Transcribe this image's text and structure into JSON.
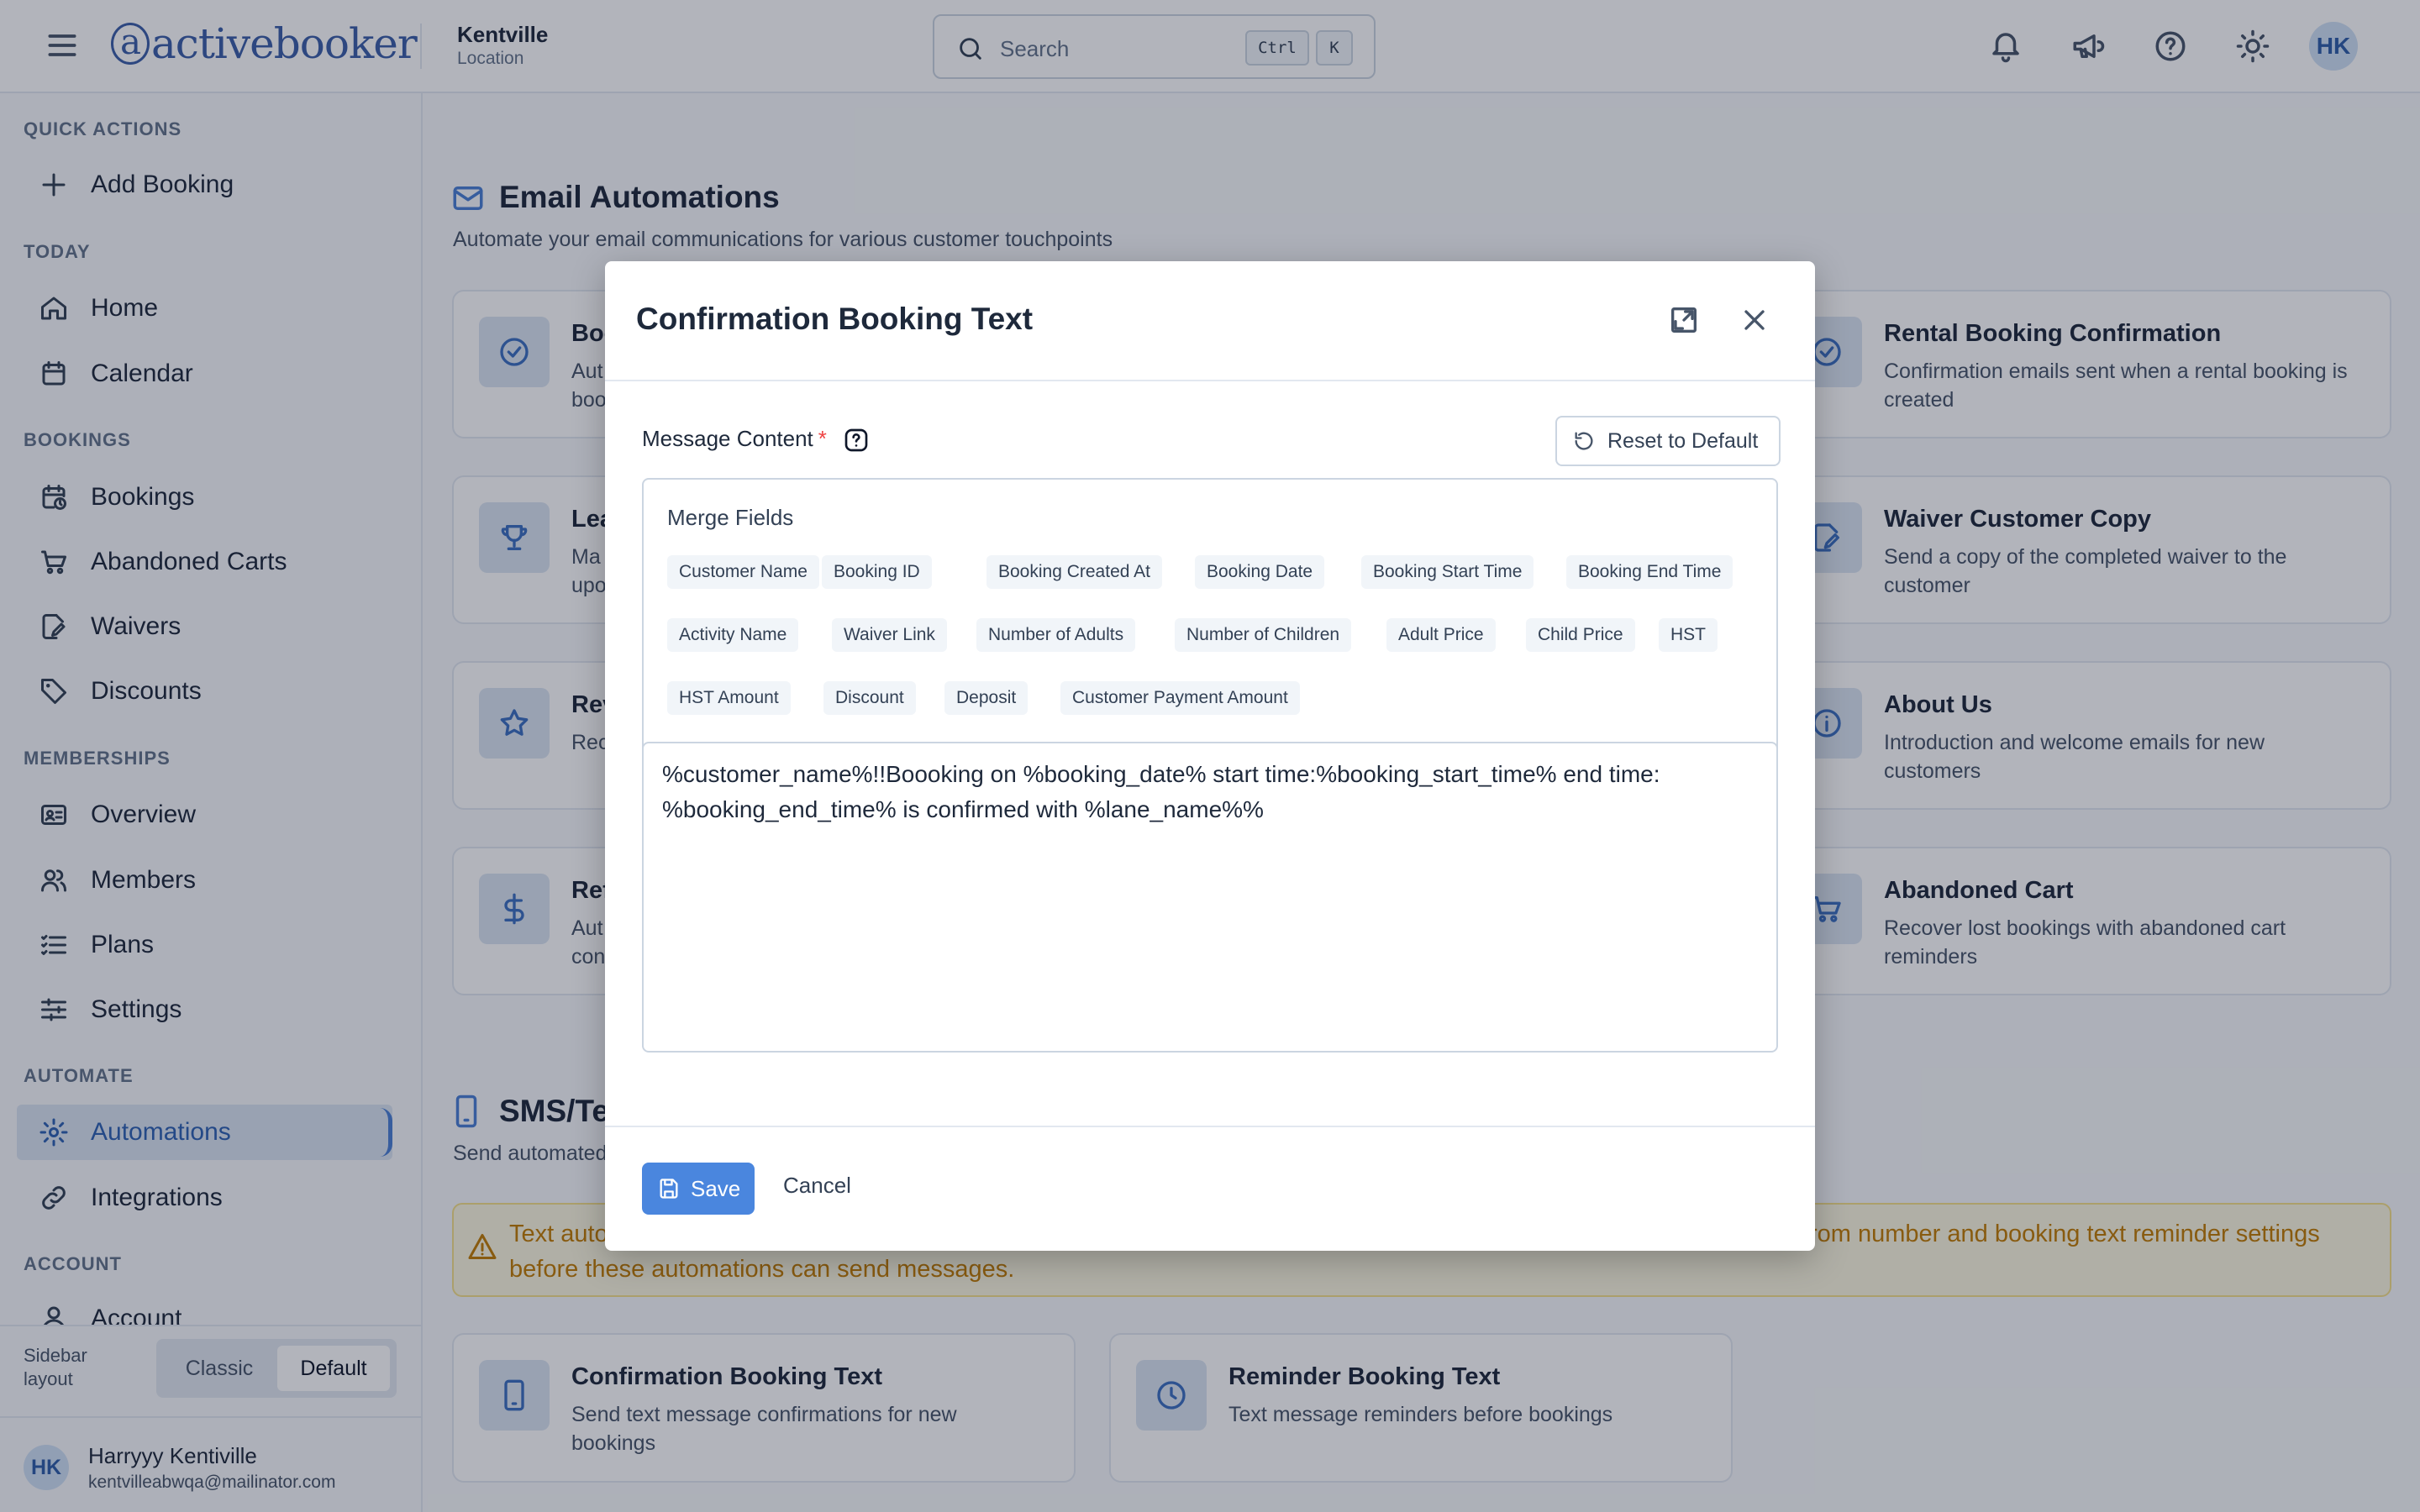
{
  "topbar": {
    "logo_text": "activebooker",
    "location_name": "Kentville",
    "location_sub": "Location",
    "search_placeholder": "Search",
    "kbd_ctrl": "Ctrl",
    "kbd_k": "K",
    "avatar_initials": "HK"
  },
  "sidebar": {
    "sections": {
      "quick_actions": "QUICK ACTIONS",
      "today": "TODAY",
      "bookings": "BOOKINGS",
      "memberships": "MEMBERSHIPS",
      "automate": "AUTOMATE",
      "account": "ACCOUNT"
    },
    "items": {
      "add_booking": "Add Booking",
      "home": "Home",
      "calendar": "Calendar",
      "bookings": "Bookings",
      "abandoned_carts": "Abandoned Carts",
      "waivers": "Waivers",
      "discounts": "Discounts",
      "overview": "Overview",
      "members": "Members",
      "plans": "Plans",
      "settings": "Settings",
      "automations": "Automations",
      "integrations": "Integrations",
      "account": "Account"
    },
    "layout_label": "Sidebar layout",
    "layout_classic": "Classic",
    "layout_default": "Default",
    "user_initials": "HK",
    "user_name": "Harryyy Kentiville",
    "user_email": "kentvilleabwqa@mailinator.com"
  },
  "main": {
    "email_title": "Email Automations",
    "email_sub": "Automate your email communications for various customer touchpoints",
    "cards_left": [
      {
        "title": "Boo",
        "desc1": "Aut",
        "desc2": "boo"
      },
      {
        "title": "Lea",
        "desc1": "Ma",
        "desc2": "upo"
      },
      {
        "title": "Rev",
        "desc1": "Rec",
        "desc2": ""
      },
      {
        "title": "Ref",
        "desc1": "Aut",
        "desc2": "con"
      }
    ],
    "cards_right": [
      {
        "title": "Rental Booking Confirmation",
        "desc": "Confirmation emails sent when a rental booking is created"
      },
      {
        "title": "Waiver Customer Copy",
        "desc": "Send a copy of the completed waiver to the customer"
      },
      {
        "title": "About Us",
        "desc": "Introduction and welcome emails for new customers"
      },
      {
        "title": "Abandoned Cart",
        "desc": "Recover lost bookings with abandoned cart reminders"
      }
    ],
    "sms_title": "SMS/Te",
    "sms_sub": "Send automated",
    "warning_left1": "Text auto",
    "warning_right1": "rom number and booking text reminder settings",
    "warning_line2": "before these automations can send messages.",
    "sms_cards": [
      {
        "title": "Confirmation Booking Text",
        "desc": "Send text message confirmations for new bookings"
      },
      {
        "title": "Reminder Booking Text",
        "desc": "Text message reminders before bookings"
      }
    ]
  },
  "modal": {
    "title": "Confirmation Booking Text",
    "message_label": "Message Content",
    "required_mark": "*",
    "reset_label": "Reset to Default",
    "merge_title": "Merge Fields",
    "merge_fields": [
      "Customer Name",
      "Booking ID",
      "Booking Created At",
      "Booking Date",
      "Booking Start Time",
      "Booking End Time",
      "Activity Name",
      "Waiver Link",
      "Number of Adults",
      "Number of Children",
      "Adult Price",
      "Child Price",
      "HST",
      "HST Amount",
      "Discount",
      "Deposit",
      "Customer Payment Amount"
    ],
    "message_text": "%customer_name%!!Boooking on %booking_date% start time:%booking_start_time% end time: %booking_end_time% is confirmed with %lane_name%%",
    "save_label": "Save",
    "cancel_label": "Cancel"
  },
  "colors": {
    "accent": "#4a86de",
    "brand": "#3b5fa8",
    "warning_text": "#c27c04",
    "warning_bg": "#fdf8e1"
  }
}
